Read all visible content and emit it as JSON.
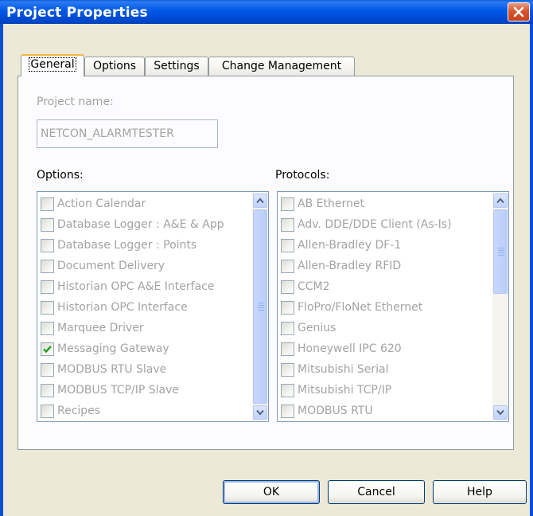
{
  "window": {
    "title": "Project Properties"
  },
  "tabs": [
    {
      "label": "General",
      "active": true
    },
    {
      "label": "Options",
      "active": false
    },
    {
      "label": "Settings",
      "active": false
    },
    {
      "label": "Change Management",
      "active": false
    }
  ],
  "general": {
    "project_name_label": "Project name:",
    "project_name_value": "NETCON_ALARMTESTER",
    "options_label": "Options:",
    "protocols_label": "Protocols:",
    "options": [
      {
        "label": "Action Calendar",
        "checked": false
      },
      {
        "label": "Database Logger : A&E & App",
        "checked": false
      },
      {
        "label": "Database Logger : Points",
        "checked": false
      },
      {
        "label": "Document Delivery",
        "checked": false
      },
      {
        "label": "Historian OPC A&E Interface",
        "checked": false
      },
      {
        "label": "Historian OPC Interface",
        "checked": false
      },
      {
        "label": "Marquee Driver",
        "checked": false
      },
      {
        "label": "Messaging Gateway",
        "checked": true
      },
      {
        "label": "MODBUS RTU Slave",
        "checked": false
      },
      {
        "label": "MODBUS TCP/IP Slave",
        "checked": false
      },
      {
        "label": "Recipes",
        "checked": false
      }
    ],
    "protocols": [
      {
        "label": "AB Ethernet",
        "checked": false
      },
      {
        "label": "Adv. DDE/DDE Client (As-Is)",
        "checked": false
      },
      {
        "label": "Allen-Bradley DF-1",
        "checked": false
      },
      {
        "label": "Allen-Bradley RFID",
        "checked": false
      },
      {
        "label": "CCM2",
        "checked": false
      },
      {
        "label": "FloPro/FloNet Ethernet",
        "checked": false
      },
      {
        "label": "Genius",
        "checked": false
      },
      {
        "label": "Honeywell IPC 620",
        "checked": false
      },
      {
        "label": "Mitsubishi Serial",
        "checked": false
      },
      {
        "label": "Mitsubishi TCP/IP",
        "checked": false
      },
      {
        "label": "MODBUS RTU",
        "checked": false
      }
    ]
  },
  "buttons": {
    "ok": "OK",
    "cancel": "Cancel",
    "help": "Help"
  },
  "icons": {
    "close": "close-icon",
    "check": "checkmark-icon",
    "scroll_up": "chevron-up-icon",
    "scroll_down": "chevron-down-icon"
  },
  "colors": {
    "titlebar": "#0058e6",
    "dialog_bg": "#ece9d8",
    "active_tab_highlight": "#f5b43f",
    "disabled_text": "#a3a3a3",
    "checkmark": "#21a121",
    "close_button": "#d6552d"
  }
}
